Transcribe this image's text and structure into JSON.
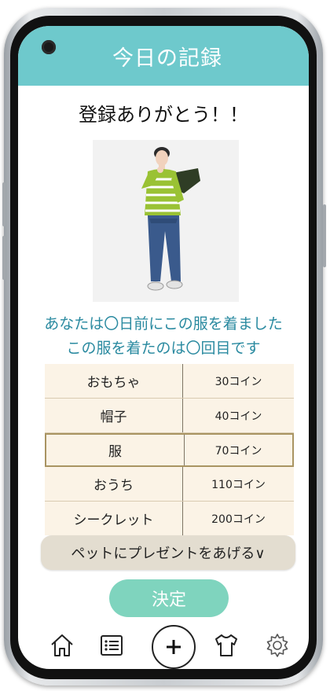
{
  "header": {
    "title": "今日の記録"
  },
  "thanks_message": "登録ありがとう！！",
  "clothing_image": {
    "description_icon": "person-in-striped-sweater-image"
  },
  "info": {
    "line1": "あなたは〇日前にこの服を着ました",
    "line2": "この服を着たのは〇回目です"
  },
  "gift_table": {
    "rows": [
      {
        "item": "おもちゃ",
        "price": "30コイン",
        "selected": false
      },
      {
        "item": "帽子",
        "price": "40コイン",
        "selected": false
      },
      {
        "item": "服",
        "price": "70コイン",
        "selected": true
      },
      {
        "item": "おうち",
        "price": "110コイン",
        "selected": false
      },
      {
        "item": "シークレット",
        "price": "200コイン",
        "selected": false
      }
    ]
  },
  "present_button": {
    "label": "ペットにプレゼントをあげる∨"
  },
  "decide_button": {
    "label": "決定"
  },
  "bottom_nav": {
    "items": [
      "home-icon",
      "list-icon",
      "add-icon",
      "shirt-icon",
      "settings-icon"
    ]
  },
  "colors": {
    "header": "#6ec9cc",
    "accent_text": "#2a8aa0",
    "table_bg": "#fbf3e6",
    "decide_button": "#7fd4be"
  }
}
